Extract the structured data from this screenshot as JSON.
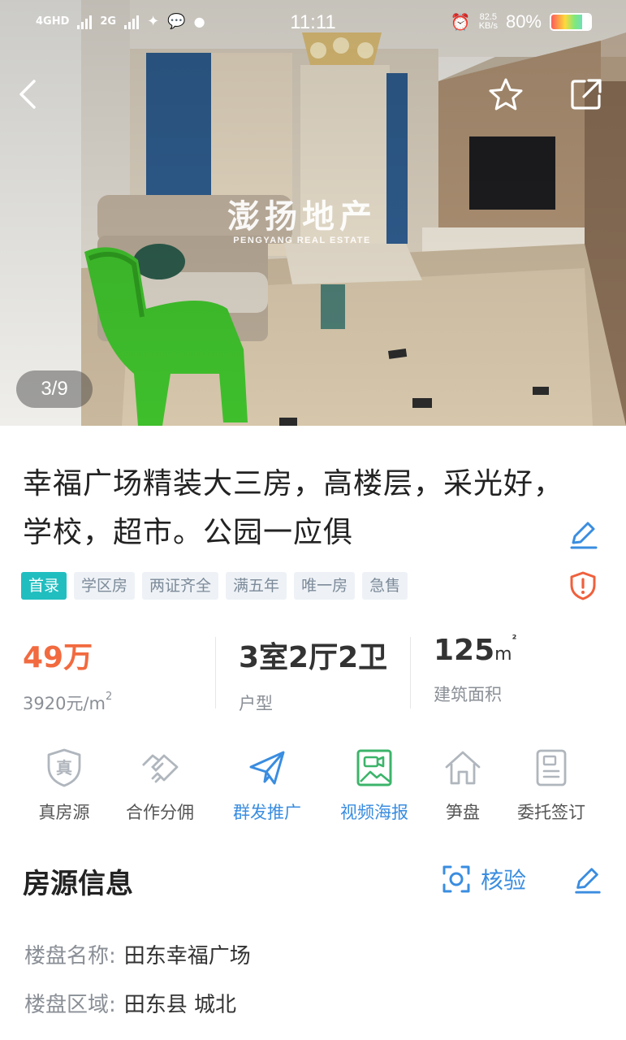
{
  "status_bar": {
    "network_1": "4GHD",
    "network_2": "2G",
    "time": "11:11",
    "speed_value": "82.5",
    "speed_unit": "KB/s",
    "battery": "80%",
    "battery_level": 0.8
  },
  "photo": {
    "watermark_cn": "澎扬地产",
    "watermark_en": "PENGYANG REAL ESTATE",
    "counter": "3/9"
  },
  "listing": {
    "title": "幸福广场精装大三房，高楼层，采光好，学校，超市。公园一应俱",
    "tags": [
      "首录",
      "学区房",
      "两证齐全",
      "满五年",
      "唯一房",
      "急售"
    ]
  },
  "stats": {
    "price": "49万",
    "unit_price": "3920元/m",
    "unit_price_sup": "2",
    "layout": "3室2厅2卫",
    "layout_label": "户型",
    "area": "125",
    "area_unit": "m",
    "area_sup": "²",
    "area_label": "建筑面积"
  },
  "actions": [
    {
      "label": "真房源",
      "icon": "shield-true-icon",
      "icon_char": "真"
    },
    {
      "label": "合作分佣",
      "icon": "handshake-icon"
    },
    {
      "label": "群发推广",
      "icon": "paper-plane-icon"
    },
    {
      "label": "视频海报",
      "icon": "video-poster-icon"
    },
    {
      "label": "笋盘",
      "icon": "house-icon"
    },
    {
      "label": "委托签订",
      "icon": "document-icon"
    }
  ],
  "info": {
    "section_title": "房源信息",
    "verify_label": "核验",
    "rows": [
      {
        "key": "楼盘名称:",
        "value": "田东幸福广场"
      },
      {
        "key": "楼盘区域:",
        "value": "田东县 城北"
      }
    ]
  },
  "colors": {
    "accent_blue": "#3a8de0",
    "price_orange": "#f26a3f",
    "tag_primary": "#21bec0",
    "warning_red": "#f0603c",
    "video_green": "#3cb46a"
  }
}
